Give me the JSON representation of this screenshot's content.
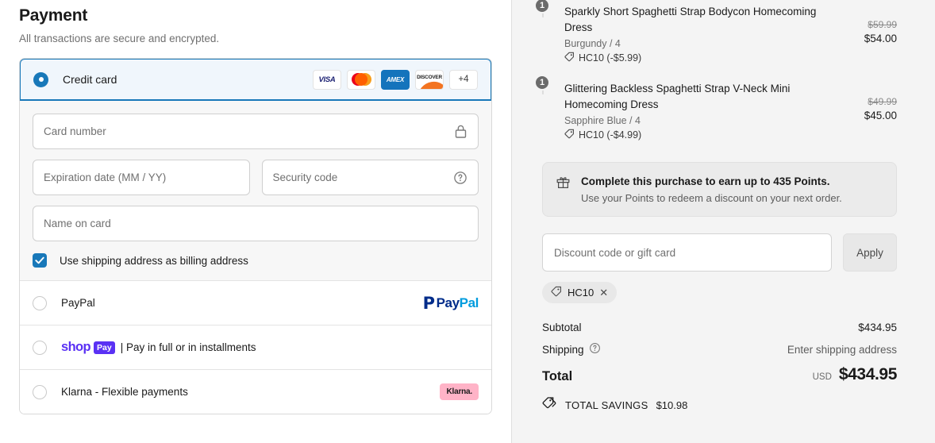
{
  "payment": {
    "title": "Payment",
    "subtitle": "All transactions are secure and encrypted.",
    "credit_card": {
      "label": "Credit card",
      "selected": true,
      "brands": [
        "visa",
        "mastercard",
        "amex",
        "discover"
      ],
      "brand_visa_text": "VISA",
      "brand_amex_text": "AMEX",
      "brand_discover_text": "DISCOVER",
      "more_brands": "+4",
      "fields": {
        "card_number_placeholder": "Card number",
        "card_number_value": "",
        "expiry_placeholder": "Expiration date (MM / YY)",
        "expiry_value": "",
        "cvv_placeholder": "Security code",
        "cvv_value": "",
        "name_placeholder": "Name on card",
        "name_value": ""
      },
      "billing_checkbox_label": "Use shipping address as billing address",
      "billing_checked": true
    },
    "other_methods": [
      {
        "label": "PayPal",
        "logo": "paypal"
      },
      {
        "label": "Pay in full or in installments",
        "logo": "shop-pay",
        "logo_text": "shop",
        "logo_badge": "Pay",
        "separator": "|"
      },
      {
        "label": "Klarna - Flexible payments",
        "logo": "klarna",
        "logo_text": "Klarna."
      }
    ],
    "accent_color": "#1878b9"
  },
  "order_summary": {
    "items": [
      {
        "qty": "1",
        "name": "Sparkly Short Spaghetti Strap Bodycon Homecoming Dress",
        "variant": "Burgundy / 4",
        "discount": "HC10 (-$5.99)",
        "compare_price": "$59.99",
        "price": "$54.00"
      },
      {
        "qty": "1",
        "name": "Glittering Backless Spaghetti Strap V-Neck Mini Homecoming Dress",
        "variant": "Sapphire Blue / 4",
        "discount": "HC10 (-$4.99)",
        "compare_price": "$49.99",
        "price": "$45.00"
      }
    ],
    "clipped_item_qty": "1",
    "points_banner": {
      "title": "Complete this purchase to earn up to 435 Points.",
      "subtitle": "Use your Points to redeem a discount on your next order.",
      "points": "435"
    },
    "discount": {
      "placeholder": "Discount code or gift card",
      "value": "",
      "apply_label": "Apply",
      "applied_codes": [
        "HC10"
      ]
    },
    "totals": {
      "subtotal_label": "Subtotal",
      "subtotal_value": "$434.95",
      "shipping_label": "Shipping",
      "shipping_value": "Enter shipping address",
      "total_label": "Total",
      "total_currency": "USD",
      "total_value": "$434.95",
      "savings_label": "TOTAL SAVINGS",
      "savings_value": "$10.98"
    }
  }
}
